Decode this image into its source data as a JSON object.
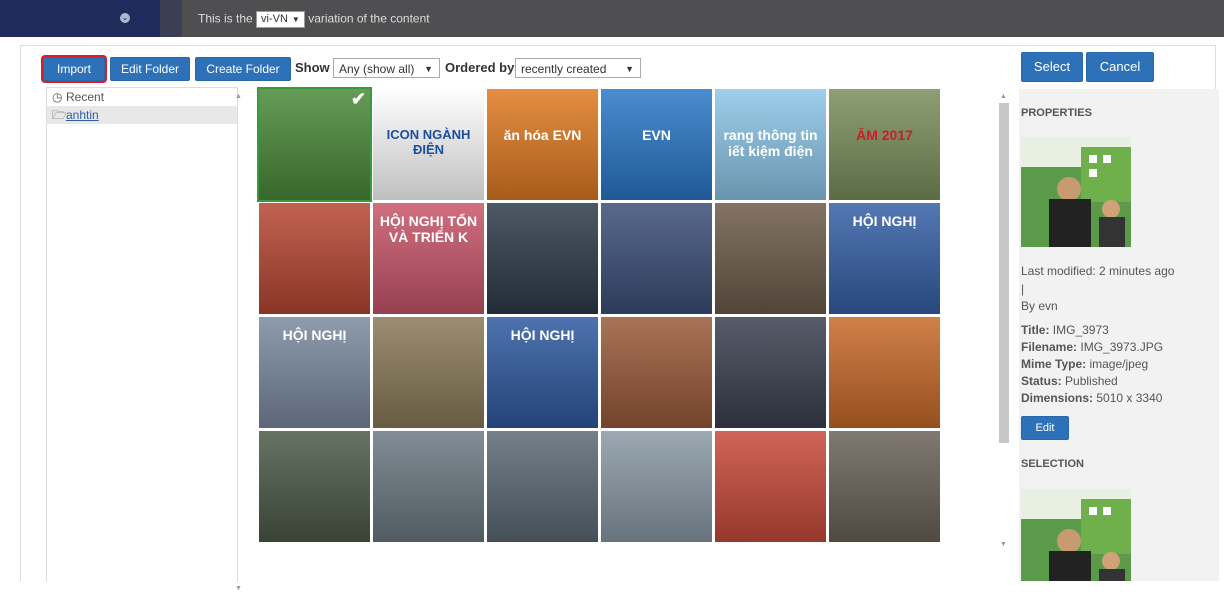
{
  "topbar": {
    "variation_prefix": "This is the",
    "language": "vi-VN",
    "variation_suffix": "variation of the content"
  },
  "toolbar": {
    "import_label": "Import",
    "edit_folder_label": "Edit Folder",
    "create_folder_label": "Create Folder",
    "show_label": "Show",
    "show_value": "Any (show all)",
    "ordered_by_label": "Ordered by",
    "ordered_by_value": "recently created",
    "select_label": "Select",
    "cancel_label": "Cancel"
  },
  "tree": {
    "items": [
      {
        "label": "Recent",
        "icon": "clock-icon"
      },
      {
        "label": "anhtin",
        "icon": "folder-open-icon"
      }
    ]
  },
  "tiles": [
    {
      "caption": "",
      "bg": "#4a8a3a"
    },
    {
      "caption": "ICON NGÀNH ĐIỆN",
      "bg": "#ffffff"
    },
    {
      "caption": "ăn hóa EVN",
      "bg": "#e07a22"
    },
    {
      "caption": "EVN",
      "bg": "#2a78c8"
    },
    {
      "caption": "rang thông tin iết kiệm điện",
      "bg": "#8cc6e8"
    },
    {
      "caption": "ĂM 2017",
      "bg": "#7b8f5c"
    },
    {
      "caption": "",
      "bg": "#b74733"
    },
    {
      "caption": "HỘI NGHỊ TỔN VÀ TRIỂN K",
      "bg": "#c8566a"
    },
    {
      "caption": "",
      "bg": "#2e3b4a"
    },
    {
      "caption": "",
      "bg": "#3c4f78"
    },
    {
      "caption": "",
      "bg": "#6d5b4a"
    },
    {
      "caption": "HỘI NGHỊ",
      "bg": "#3560a6"
    },
    {
      "caption": "HỘI NGHỊ",
      "bg": "#7a8aa0"
    },
    {
      "caption": "",
      "bg": "#8a7a58"
    },
    {
      "caption": "HỘI NGHỊ",
      "bg": "#2f5aa0"
    },
    {
      "caption": "",
      "bg": "#9a5a3a"
    },
    {
      "caption": "",
      "bg": "#3a4050"
    },
    {
      "caption": "",
      "bg": "#c86a2a"
    },
    {
      "caption": "",
      "bg": "#4c5a48"
    },
    {
      "caption": "",
      "bg": "#6a7a82"
    },
    {
      "caption": "",
      "bg": "#5b6a74"
    },
    {
      "caption": "",
      "bg": "#8a9aa6"
    },
    {
      "caption": "",
      "bg": "#c84a3a"
    },
    {
      "caption": "",
      "bg": "#6a6258"
    }
  ],
  "properties": {
    "heading": "PROPERTIES",
    "last_modified": "Last modified: 2 minutes ago |",
    "by": "By evn",
    "title_label": "Title:",
    "title_value": "IMG_3973",
    "filename_label": "Filename:",
    "filename_value": "IMG_3973.JPG",
    "mime_label": "Mime Type:",
    "mime_value": "image/jpeg",
    "status_label": "Status:",
    "status_value": "Published",
    "dimensions_label": "Dimensions:",
    "dimensions_value": "5010 x 3340",
    "edit_label": "Edit",
    "selection_heading": "SELECTION"
  },
  "colors": {
    "accent": "#2d72b8",
    "highlight": "#d81e2c",
    "selected_outline": "#3a9a3a"
  }
}
